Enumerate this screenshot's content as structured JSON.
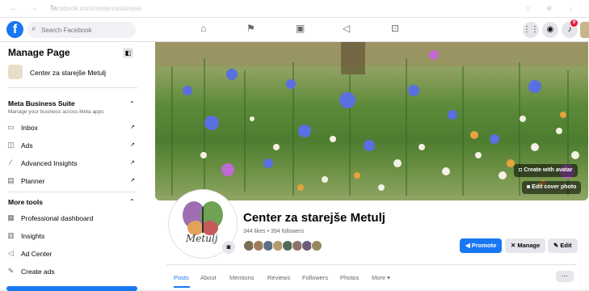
{
  "browser": {
    "nav_glyphs": "← → ↻",
    "url": "facebook.com/centerzastarejse",
    "right_glyphs": "☆ ⊕ ⋮"
  },
  "topbar": {
    "logo": "f",
    "search_placeholder": "Search Facebook",
    "icons": [
      "home-icon",
      "flag-icon",
      "news-icon",
      "megaphone-icon",
      "gaming-icon"
    ],
    "notifications_badge": "9"
  },
  "sidebar": {
    "title": "Manage Page",
    "page_name": "Center za starejše Metulj",
    "meta_suite": {
      "title": "Meta Business Suite",
      "subtitle": "Manage your business across Meta apps",
      "items": [
        {
          "label": "Inbox",
          "icon": "inbox-icon"
        },
        {
          "label": "Ads",
          "icon": "ads-icon"
        },
        {
          "label": "Advanced Insights",
          "icon": "insights-icon"
        },
        {
          "label": "Planner",
          "icon": "calendar-icon"
        }
      ]
    },
    "more_tools": {
      "title": "More tools",
      "items": [
        {
          "label": "Professional dashboard",
          "icon": "dashboard-icon"
        },
        {
          "label": "Insights",
          "icon": "chart-icon"
        },
        {
          "label": "Ad Center",
          "icon": "megaphone-icon"
        },
        {
          "label": "Create ads",
          "icon": "create-ads-icon"
        }
      ]
    }
  },
  "cover": {
    "create_avatar": "Create with avatar",
    "edit_cover": "Edit cover photo"
  },
  "profile": {
    "title": "Center za starejše Metulj",
    "stats": "344 likes • 394 followers",
    "logo_text": "Metulj",
    "actions": {
      "promote": "Promote",
      "manage": "Manage",
      "edit": "Edit"
    }
  },
  "tabs": [
    "Posts",
    "About",
    "Mentions",
    "Reviews",
    "Followers",
    "Photos",
    "More ▾"
  ],
  "colors": {
    "accent": "#1877f2",
    "badge": "#e41e3f"
  }
}
